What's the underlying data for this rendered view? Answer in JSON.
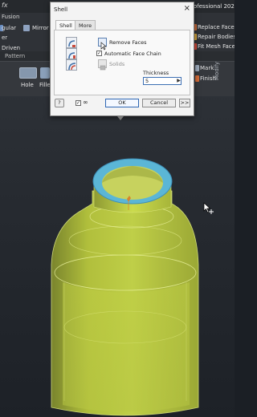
{
  "app": {
    "title_fragment": "ofessional 2025",
    "logo_glyph": "fx"
  },
  "ribbon": {
    "tab_fusion": "Fusion",
    "left_items": [
      "gular",
      "Mirror",
      "er",
      "Driven"
    ],
    "panel_pattern": "Pattern",
    "right_items": [
      "Replace Face",
      "Repair Bodies",
      "Fit Mesh Face"
    ],
    "hole_label": "Hole",
    "fillet_label": "Fille",
    "mark_label": "Mark",
    "finish_label": "Finish",
    "modify_label": "Modify"
  },
  "dialog": {
    "title": "Shell",
    "close_glyph": "×",
    "tabs": [
      "Shell",
      "More"
    ],
    "active_tab": "Shell",
    "remove_faces_label": "Remove Faces",
    "automatic_face_chain_label": "Automatic Face Chain",
    "automatic_face_chain_checked": true,
    "solids_label": "Solids",
    "thickness_label": "Thickness",
    "thickness_value": "5",
    "ok_label": "OK",
    "cancel_label": "Cancel",
    "expand_label": ">>",
    "help_glyph": "?",
    "preview_glyph": "∞"
  },
  "colors": {
    "model_yellow": "#c8d84a",
    "face_highlight": "#5bb6d6",
    "dialog_bg": "#f3f3f3",
    "viewport_bg": "#272b31"
  },
  "icons": {
    "shell_direction": [
      "shell-inside-icon",
      "shell-outside-icon",
      "shell-both-icon"
    ],
    "remove_faces": "select-arrow-icon",
    "solids": "solid-body-icon",
    "cursor": "move-cursor-icon"
  }
}
